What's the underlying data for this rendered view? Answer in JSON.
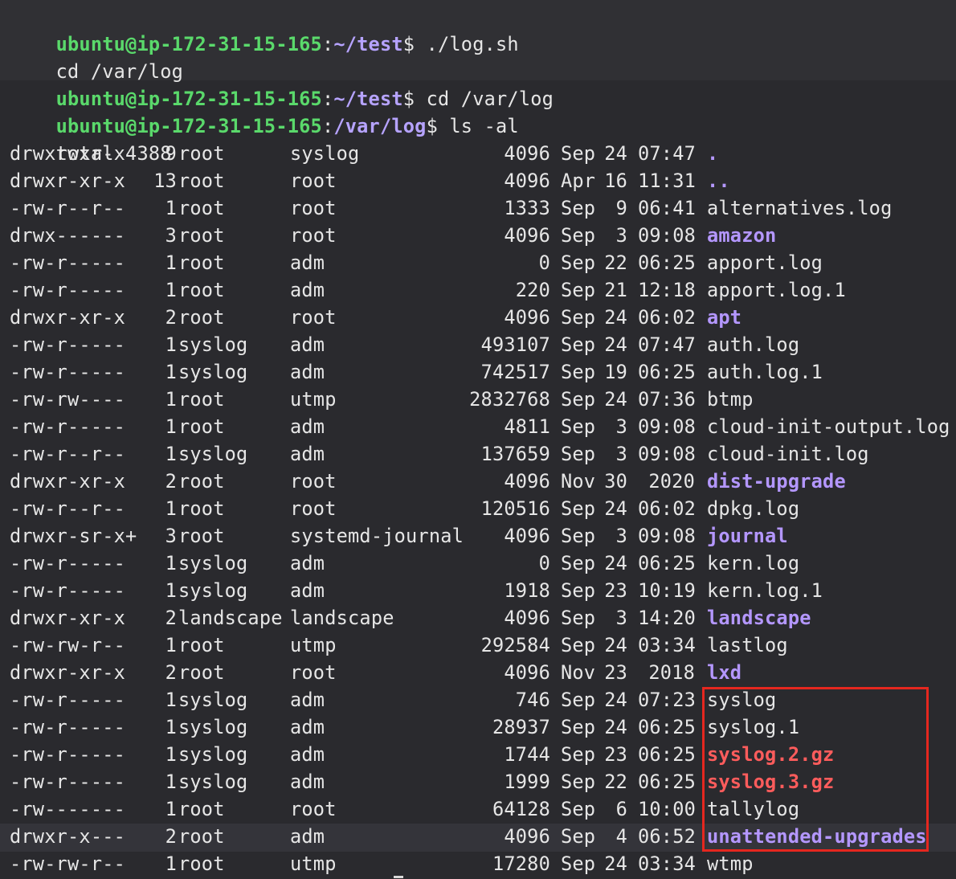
{
  "terminal": {
    "prompt_user": "ubuntu@ip-172-31-15-165",
    "commands": [
      {
        "path": "~/test",
        "command": " ./log.sh"
      },
      {
        "echo": "cd /var/log"
      },
      {
        "path": "~/test",
        "command": " cd /var/log"
      },
      {
        "path": "/var/log",
        "command": " ls -al"
      }
    ],
    "prompt_sep": ":",
    "prompt_end": "$",
    "total": "total 4388"
  },
  "listing": [
    {
      "perm": "drwxrwxr-x",
      "links": "9",
      "owner": "root",
      "group": "syslog",
      "size": "4096",
      "month": "Sep",
      "day": "24",
      "time": "07:47",
      "name": ".",
      "kind": "dir"
    },
    {
      "perm": "drwxr-xr-x",
      "links": "13",
      "owner": "root",
      "group": "root",
      "size": "4096",
      "month": "Apr",
      "day": "16",
      "time": "11:31",
      "name": "..",
      "kind": "dir"
    },
    {
      "perm": "-rw-r--r--",
      "links": "1",
      "owner": "root",
      "group": "root",
      "size": "1333",
      "month": "Sep",
      "day": "9",
      "time": "06:41",
      "name": "alternatives.log",
      "kind": "file"
    },
    {
      "perm": "drwx------",
      "links": "3",
      "owner": "root",
      "group": "root",
      "size": "4096",
      "month": "Sep",
      "day": "3",
      "time": "09:08",
      "name": "amazon",
      "kind": "dir"
    },
    {
      "perm": "-rw-r-----",
      "links": "1",
      "owner": "root",
      "group": "adm",
      "size": "0",
      "month": "Sep",
      "day": "22",
      "time": "06:25",
      "name": "apport.log",
      "kind": "file"
    },
    {
      "perm": "-rw-r-----",
      "links": "1",
      "owner": "root",
      "group": "adm",
      "size": "220",
      "month": "Sep",
      "day": "21",
      "time": "12:18",
      "name": "apport.log.1",
      "kind": "file"
    },
    {
      "perm": "drwxr-xr-x",
      "links": "2",
      "owner": "root",
      "group": "root",
      "size": "4096",
      "month": "Sep",
      "day": "24",
      "time": "06:02",
      "name": "apt",
      "kind": "dir"
    },
    {
      "perm": "-rw-r-----",
      "links": "1",
      "owner": "syslog",
      "group": "adm",
      "size": "493107",
      "month": "Sep",
      "day": "24",
      "time": "07:47",
      "name": "auth.log",
      "kind": "file"
    },
    {
      "perm": "-rw-r-----",
      "links": "1",
      "owner": "syslog",
      "group": "adm",
      "size": "742517",
      "month": "Sep",
      "day": "19",
      "time": "06:25",
      "name": "auth.log.1",
      "kind": "file"
    },
    {
      "perm": "-rw-rw----",
      "links": "1",
      "owner": "root",
      "group": "utmp",
      "size": "2832768",
      "month": "Sep",
      "day": "24",
      "time": "07:36",
      "name": "btmp",
      "kind": "file"
    },
    {
      "perm": "-rw-r-----",
      "links": "1",
      "owner": "root",
      "group": "adm",
      "size": "4811",
      "month": "Sep",
      "day": "3",
      "time": "09:08",
      "name": "cloud-init-output.log",
      "kind": "file"
    },
    {
      "perm": "-rw-r--r--",
      "links": "1",
      "owner": "syslog",
      "group": "adm",
      "size": "137659",
      "month": "Sep",
      "day": "3",
      "time": "09:08",
      "name": "cloud-init.log",
      "kind": "file"
    },
    {
      "perm": "drwxr-xr-x",
      "links": "2",
      "owner": "root",
      "group": "root",
      "size": "4096",
      "month": "Nov",
      "day": "30",
      "time": "2020",
      "name": "dist-upgrade",
      "kind": "dir"
    },
    {
      "perm": "-rw-r--r--",
      "links": "1",
      "owner": "root",
      "group": "root",
      "size": "120516",
      "month": "Sep",
      "day": "24",
      "time": "06:02",
      "name": "dpkg.log",
      "kind": "file"
    },
    {
      "perm": "drwxr-sr-x+",
      "links": "3",
      "owner": "root",
      "group": "systemd-journal",
      "size": "4096",
      "month": "Sep",
      "day": "3",
      "time": "09:08",
      "name": "journal",
      "kind": "dir"
    },
    {
      "perm": "-rw-r-----",
      "links": "1",
      "owner": "syslog",
      "group": "adm",
      "size": "0",
      "month": "Sep",
      "day": "24",
      "time": "06:25",
      "name": "kern.log",
      "kind": "file"
    },
    {
      "perm": "-rw-r-----",
      "links": "1",
      "owner": "syslog",
      "group": "adm",
      "size": "1918",
      "month": "Sep",
      "day": "23",
      "time": "10:19",
      "name": "kern.log.1",
      "kind": "file"
    },
    {
      "perm": "drwxr-xr-x",
      "links": "2",
      "owner": "landscape",
      "group": "landscape",
      "size": "4096",
      "month": "Sep",
      "day": "3",
      "time": "14:20",
      "name": "landscape",
      "kind": "dir"
    },
    {
      "perm": "-rw-rw-r--",
      "links": "1",
      "owner": "root",
      "group": "utmp",
      "size": "292584",
      "month": "Sep",
      "day": "24",
      "time": "03:34",
      "name": "lastlog",
      "kind": "file"
    },
    {
      "perm": "drwxr-xr-x",
      "links": "2",
      "owner": "root",
      "group": "root",
      "size": "4096",
      "month": "Nov",
      "day": "23",
      "time": "2018",
      "name": "lxd",
      "kind": "dir"
    },
    {
      "perm": "-rw-r-----",
      "links": "1",
      "owner": "syslog",
      "group": "adm",
      "size": "746",
      "month": "Sep",
      "day": "24",
      "time": "07:23",
      "name": "syslog",
      "kind": "file"
    },
    {
      "perm": "-rw-r-----",
      "links": "1",
      "owner": "syslog",
      "group": "adm",
      "size": "28937",
      "month": "Sep",
      "day": "24",
      "time": "06:25",
      "name": "syslog.1",
      "kind": "file"
    },
    {
      "perm": "-rw-r-----",
      "links": "1",
      "owner": "syslog",
      "group": "adm",
      "size": "1744",
      "month": "Sep",
      "day": "23",
      "time": "06:25",
      "name": "syslog.2.gz",
      "kind": "archive"
    },
    {
      "perm": "-rw-r-----",
      "links": "1",
      "owner": "syslog",
      "group": "adm",
      "size": "1999",
      "month": "Sep",
      "day": "22",
      "time": "06:25",
      "name": "syslog.3.gz",
      "kind": "archive"
    },
    {
      "perm": "-rw-------",
      "links": "1",
      "owner": "root",
      "group": "root",
      "size": "64128",
      "month": "Sep",
      "day": "6",
      "time": "10:00",
      "name": "tallylog",
      "kind": "file"
    },
    {
      "perm": "drwxr-x---",
      "links": "2",
      "owner": "root",
      "group": "adm",
      "size": "4096",
      "month": "Sep",
      "day": "4",
      "time": "06:52",
      "name": "unattended-upgrades",
      "kind": "dir"
    },
    {
      "perm": "-rw-rw-r--",
      "links": "1",
      "owner": "root",
      "group": "utmp",
      "size": "17280",
      "month": "Sep",
      "day": "24",
      "time": "03:34",
      "name": "wtmp",
      "kind": "file"
    }
  ],
  "colors": {
    "prompt_user": "#5ad96b",
    "prompt_path": "#b6a3ff",
    "directory": "#b497ff",
    "archive": "#ff5c5c",
    "highlight_border": "#e5271f"
  }
}
